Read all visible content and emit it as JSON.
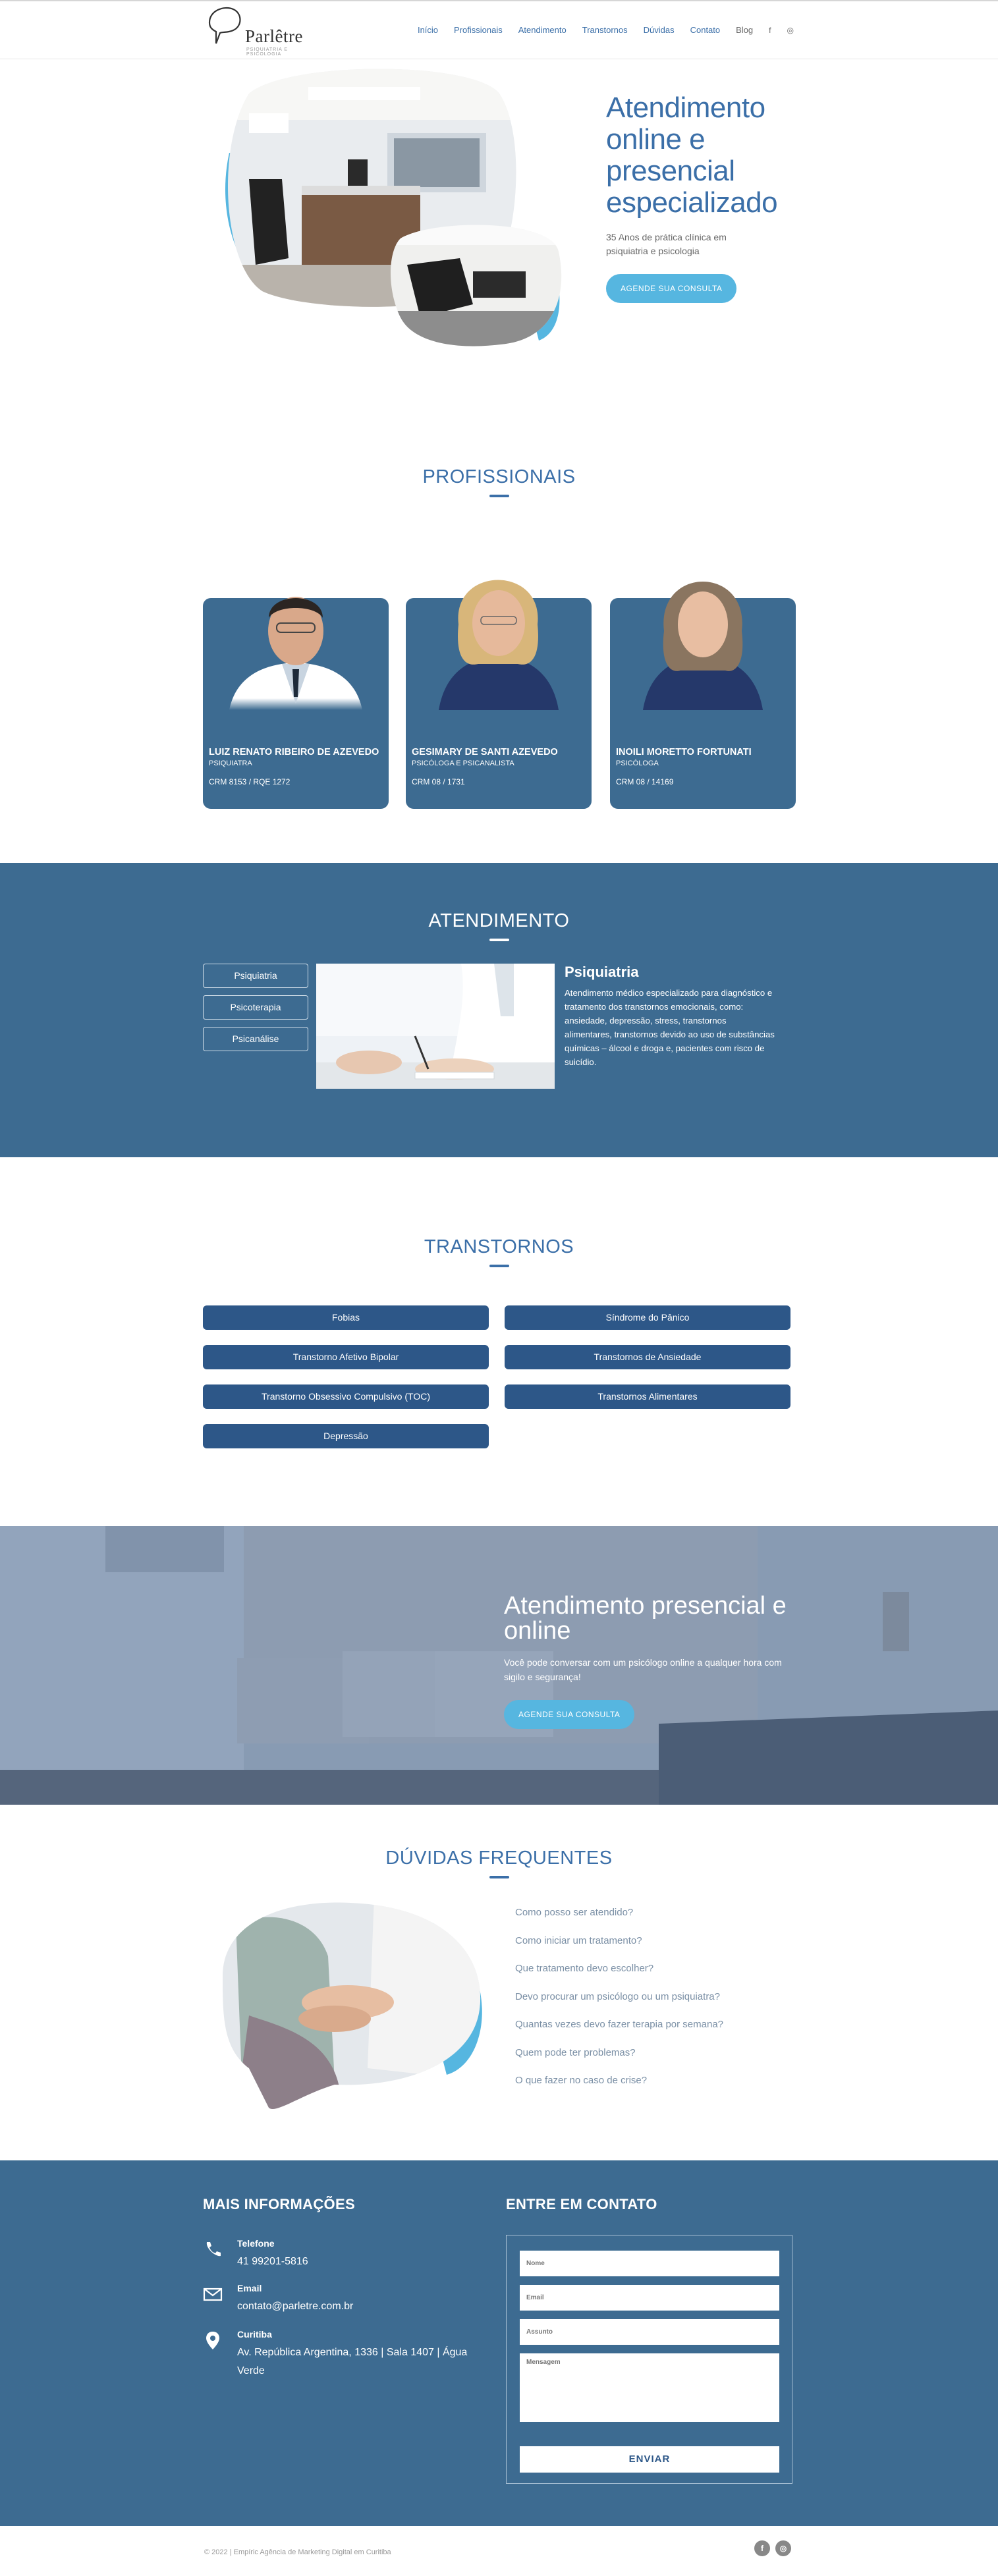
{
  "header": {
    "logo_name": "Parlêtre",
    "logo_sub": "PSIQUIATRIA E PSICOLOGIA",
    "nav": [
      "Início",
      "Profissionais",
      "Atendimento",
      "Transtornos",
      "Dúvidas",
      "Contato",
      "Blog"
    ],
    "social": {
      "facebook": "f",
      "instagram": "◎"
    }
  },
  "hero": {
    "title": "Atendimento online e presencial especializado",
    "subtitle": "35 Anos de prática clínica em psiquiatria e psicologia",
    "button": "AGENDE SUA CONSULTA"
  },
  "profissionais": {
    "title": "PROFISSIONAIS",
    "cards": [
      {
        "name": "LUIZ RENATO RIBEIRO DE AZEVEDO",
        "role": "PSIQUIATRA",
        "crm": "CRM 8153 / RQE 1272"
      },
      {
        "name": "GESIMARY DE SANTI AZEVEDO",
        "role": "PSICÓLOGA E PSICANALISTA",
        "crm": "CRM 08 / 1731"
      },
      {
        "name": "INOILI MORETTO FORTUNATI",
        "role": "PSICÓLOGA",
        "crm": "CRM 08 / 14169"
      }
    ]
  },
  "atendimento": {
    "title": "ATENDIMENTO",
    "tabs": [
      "Psiquiatria",
      "Psicoterapia",
      "Psicanálise"
    ],
    "content_title": "Psiquiatria",
    "content_desc": "Atendimento médico especializado para diagnóstico e tratamento dos transtornos emocionais, como: ansiedade, depressão, stress, transtornos alimentares, transtornos devido ao uso de substâncias químicas – álcool e droga e, pacientes com risco de suicídio."
  },
  "transtornos": {
    "title": "TRANSTORNOS",
    "items": [
      "Fobias",
      "Síndrome do Pânico",
      "Transtorno Afetivo Bipolar",
      "Transtornos de Ansiedade",
      "Transtorno Obsessivo Compulsivo (TOC)",
      "Transtornos Alimentares",
      "Depressão"
    ]
  },
  "banner": {
    "title": "Atendimento presencial e online",
    "desc": "Você pode conversar com um psicólogo online a qualquer hora com sigilo e segurança!",
    "button": "AGENDE SUA CONSULTA"
  },
  "duvidas": {
    "title": "DÚVIDAS FREQUENTES",
    "items": [
      "Como posso ser atendido?",
      "Como iniciar um tratamento?",
      "Que tratamento devo escolher?",
      "Devo procurar um psicólogo ou um psiquiatra?",
      "Quantas vezes devo fazer terapia por semana?",
      "Quem pode ter problemas?",
      "O que fazer no caso de crise?"
    ]
  },
  "footer": {
    "info_title": "MAIS INFORMAÇÕES",
    "contact_title": "ENTRE EM CONTATO",
    "phone_label": "Telefone",
    "phone": "41 99201-5816",
    "email_label": "Email",
    "email": "contato@parletre.com.br",
    "city_label": "Curitiba",
    "address": "Av. República Argentina, 1336 | Sala 1407 | Água Verde",
    "form": {
      "name": "Nome",
      "email": "Email",
      "subject": "Assunto",
      "message": "Mensagem",
      "submit": "ENVIAR"
    }
  },
  "bottom": {
    "copyright": "© 2022 | Empíric Agência de Marketing Digital em Curitiba",
    "social": [
      "f",
      "◎"
    ]
  },
  "colors": {
    "primary": "#3b6fa8",
    "section_bg": "#3d6b91",
    "accent": "#56b6e0",
    "button_dark": "#2d5788"
  }
}
